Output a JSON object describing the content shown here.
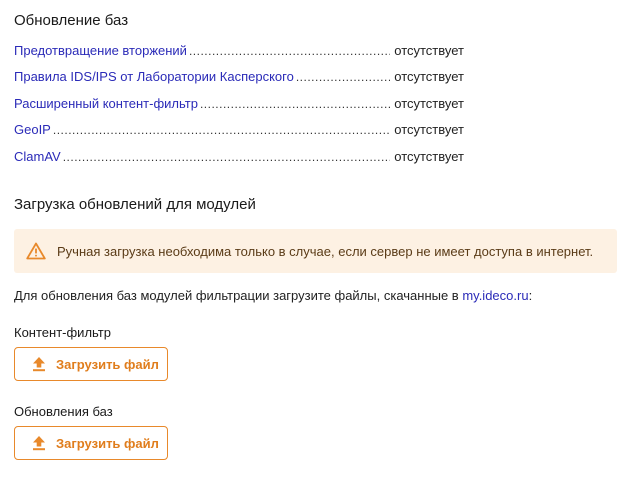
{
  "databases": {
    "title": "Обновление баз",
    "items": [
      {
        "name": "Предотвращение вторжений",
        "status": "отсутствует"
      },
      {
        "name": "Правила IDS/IPS от Лаборатории Касперского",
        "status": "отсутствует"
      },
      {
        "name": "Расширенный контент-фильтр",
        "status": "отсутствует"
      },
      {
        "name": "GeoIP",
        "status": "отсутствует"
      },
      {
        "name": "ClamAV",
        "status": "отсутствует"
      }
    ]
  },
  "upload": {
    "title": "Загрузка обновлений для модулей",
    "warning": {
      "icon": "warning-triangle-icon",
      "text": "Ручная загрузка необходима только в случае, если сервер не имеет доступа в интернет."
    },
    "instructions": {
      "prefix": "Для обновления баз модулей фильтрации загрузите файлы, скачанные в ",
      "link": "my.ideco.ru",
      "suffix": ":"
    },
    "content_filter": {
      "label": "Контент-фильтр",
      "button": "Загрузить файл",
      "icon": "upload-icon"
    },
    "bases": {
      "label": "Обновления баз",
      "button": "Загрузить файл",
      "icon": "upload-icon"
    }
  },
  "colors": {
    "link": "#2b2bb8",
    "accent": "#e8892b",
    "warning_bg": "#fdf1e3"
  }
}
